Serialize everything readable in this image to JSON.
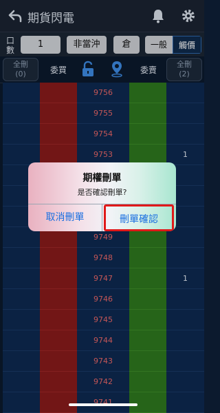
{
  "header": {
    "title": "期貨閃電",
    "back_icon": "back-arrow-icon",
    "bell_icon": "bell-icon",
    "gear_icon": "gear-icon"
  },
  "controls": {
    "qty_label": "口數",
    "qty_value": "1",
    "non_daytrade": "非當沖",
    "warehouse": "倉",
    "mode_normal": "一般",
    "mode_touch": "觸價"
  },
  "table_header": {
    "cancel_all_left": "全刪\n(0)",
    "cancel_all_right": "全刪\n(2)",
    "buy_label": "委買",
    "sell_label": "委賣",
    "lock_icon": "unlock-icon",
    "locate_icon": "location-pin-icon"
  },
  "rows": [
    {
      "price": "9756",
      "right": ""
    },
    {
      "price": "9755",
      "right": ""
    },
    {
      "price": "9754",
      "right": ""
    },
    {
      "price": "9753",
      "right": "1"
    },
    {
      "price": "",
      "right": ""
    },
    {
      "price": "",
      "right": ""
    },
    {
      "price": "",
      "right": ""
    },
    {
      "price": "9749",
      "right": ""
    },
    {
      "price": "9748",
      "right": ""
    },
    {
      "price": "9747",
      "right": "1"
    },
    {
      "price": "9746",
      "right": ""
    },
    {
      "price": "9745",
      "right": ""
    },
    {
      "price": "9744",
      "right": ""
    },
    {
      "price": "9743",
      "right": ""
    },
    {
      "price": "9742",
      "right": ""
    },
    {
      "price": "9741",
      "right": ""
    }
  ],
  "dialog": {
    "title": "期權刪單",
    "message": "是否確認刪單?",
    "cancel": "取消刪單",
    "confirm": "刪單確認"
  },
  "colors": {
    "buy": "#8b1c1c",
    "sell": "#2f7b1f",
    "price_text": "#f06a6a",
    "accent": "#1a6fe0",
    "highlight": "#e01919"
  }
}
